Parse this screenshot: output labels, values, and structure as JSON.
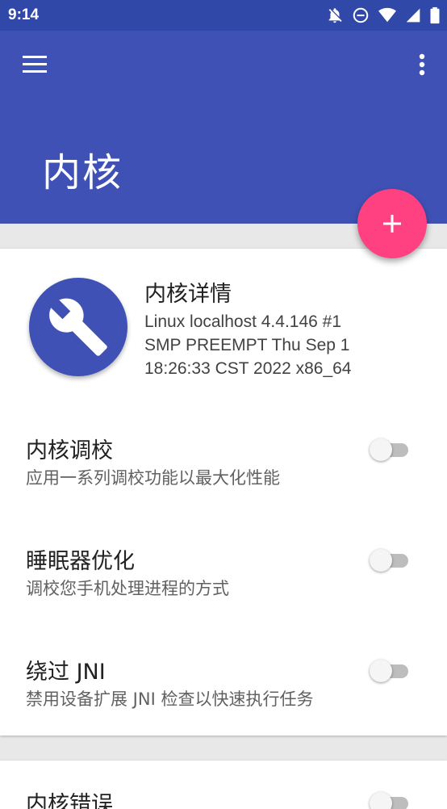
{
  "status_bar": {
    "time": "9:14",
    "icons": [
      "notifications-off-icon",
      "do-not-disturb-icon",
      "wifi-icon",
      "signal-icon",
      "battery-icon"
    ]
  },
  "app_bar": {
    "title": "内核",
    "menu_icon": "hamburger-menu-icon",
    "overflow_icon": "more-vert-icon",
    "fab_icon": "plus-icon"
  },
  "kernel_card": {
    "title": "内核详情",
    "info": "Linux localhost 4.4.146 #1\nSMP PREEMPT Thu Sep 1\n18:26:33 CST 2022 x86_64"
  },
  "settings": [
    {
      "title": "内核调校",
      "subtitle": "应用一系列调校功能以最大化性能",
      "enabled": false
    },
    {
      "title": "睡眠器优化",
      "subtitle": "调校您手机处理进程的方式",
      "enabled": false
    },
    {
      "title": "绕过 JNI",
      "subtitle": "禁用设备扩展 JNI 检查以快速执行任务",
      "enabled": false
    }
  ],
  "next_card": {
    "title": "内核错误"
  },
  "colors": {
    "primary": "#3f51b5",
    "primary_dark": "#3048a8",
    "accent": "#ff4081"
  }
}
